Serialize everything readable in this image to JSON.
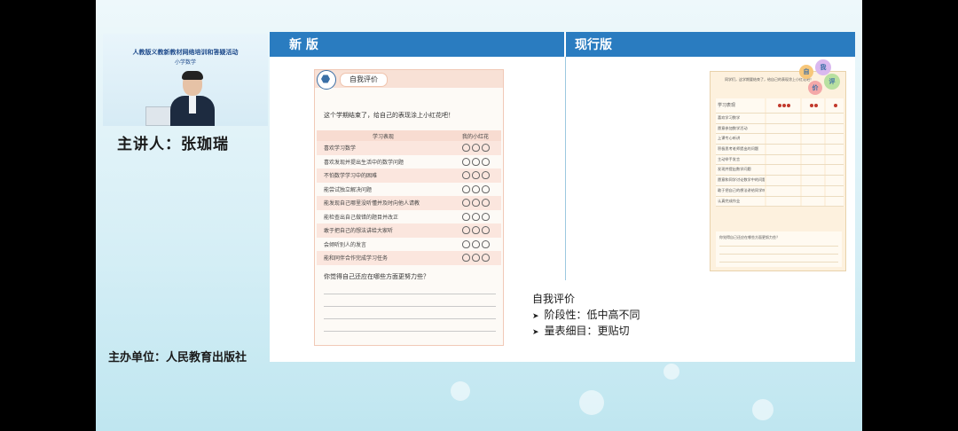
{
  "left": {
    "video": {
      "small_text": "",
      "title": "人教版义教新教材网络培训和答疑活动",
      "subtitle": "小学数学"
    },
    "speaker": "主讲人：张珈瑞",
    "organizer": "主办单位：人民教育出版社"
  },
  "slide": {
    "header_new": "新  版",
    "header_current": "现行版",
    "new_card": {
      "pill": "自我评价",
      "intro": "这个学期结束了，给自己的表现涂上小红花吧！",
      "col_performance": "学习表现",
      "col_flowers": "我的小红花",
      "rows": [
        "喜欢学习数学",
        "喜欢发现并提出生活中的数学问题",
        "不怕数学学习中的困难",
        "能尝试独立解决问题",
        "能发现自己哪里没听懂并及时向他人请教",
        "能检查出自己做错的题目并改正",
        "敢于把自己的想法讲给大家听",
        "会倾听别人的发言",
        "能和同伴合作完成学习任务"
      ],
      "question": "你觉得自己还应在哪些方面更努力些？"
    },
    "current_card": {
      "intro": "同学们，这学期要结束了，给自己的表现涂上小红花吧！",
      "bubble_chars": [
        "自",
        "我",
        "评",
        "价"
      ],
      "col_label": "学习表现",
      "rows": [
        "喜欢学习数学",
        "愿意参加数学活动",
        "上课专心听讲",
        "积极思考老师提出的问题",
        "主动举手发言",
        "发现并提出数学问题",
        "愿意和同学讨论数学中的问题",
        "敢于把自己的想法讲给同学听",
        "认真完成作业"
      ],
      "question": "你觉得自己还应在哪些方面更努力些？"
    },
    "notes": {
      "title": "自我评价",
      "items": [
        "阶段性：低中高不同",
        "量表细目：更贴切"
      ],
      "bullet_icon": "arrow-right-icon"
    }
  },
  "colors": {
    "header_blue": "#2a7cc0",
    "card_pink": "#fbe6de",
    "card_cream": "#fdf1de",
    "flower_red": "#c2392b"
  }
}
